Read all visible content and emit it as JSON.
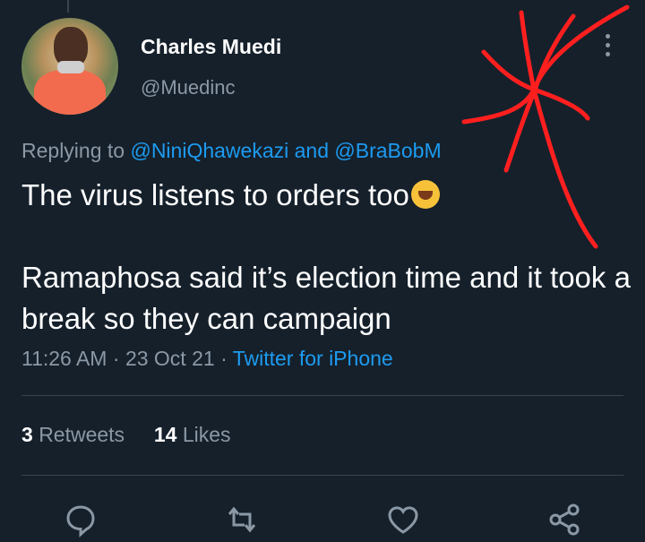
{
  "author": {
    "name": "Charles Muedi",
    "handle": "@Muedinc"
  },
  "reply": {
    "prefix": "Replying to",
    "mention1": "@NiniQhawekazi",
    "conjunction": "and",
    "mention2": "@BraBobM"
  },
  "tweet": {
    "line1": "The virus listens to orders too",
    "line2": "Ramaphosa said it’s election time and it took a break so they can campaign",
    "emoji": "rolling-on-the-floor-laughing"
  },
  "meta": {
    "time": "11:26 AM",
    "separator": "·",
    "date": "23 Oct 21",
    "source": "Twitter for iPhone"
  },
  "stats": {
    "retweets_count": "3",
    "retweets_label": "Retweets",
    "likes_count": "14",
    "likes_label": "Likes"
  },
  "actions": [
    "reply-icon",
    "retweet-icon",
    "like-icon",
    "share-icon"
  ],
  "colors": {
    "background": "#15202b",
    "link": "#1d9bf0",
    "secondary_text": "#8b98a5",
    "scribble": "#ff1f1f"
  }
}
